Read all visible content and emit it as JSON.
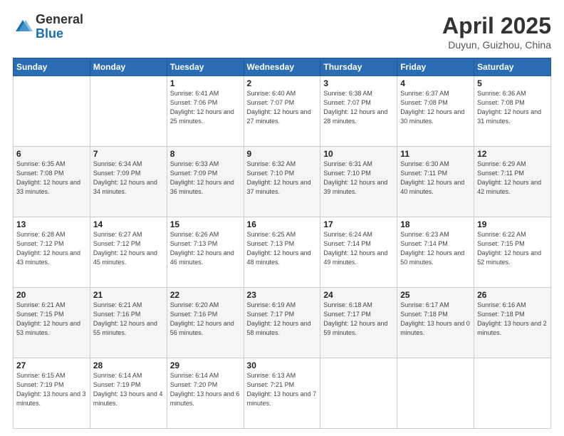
{
  "logo": {
    "general": "General",
    "blue": "Blue"
  },
  "title": "April 2025",
  "location": "Duyun, Guizhou, China",
  "weekdays": [
    "Sunday",
    "Monday",
    "Tuesday",
    "Wednesday",
    "Thursday",
    "Friday",
    "Saturday"
  ],
  "weeks": [
    [
      null,
      null,
      {
        "day": "1",
        "sunrise": "6:41 AM",
        "sunset": "7:06 PM",
        "daylight": "12 hours and 25 minutes."
      },
      {
        "day": "2",
        "sunrise": "6:40 AM",
        "sunset": "7:07 PM",
        "daylight": "12 hours and 27 minutes."
      },
      {
        "day": "3",
        "sunrise": "6:38 AM",
        "sunset": "7:07 PM",
        "daylight": "12 hours and 28 minutes."
      },
      {
        "day": "4",
        "sunrise": "6:37 AM",
        "sunset": "7:08 PM",
        "daylight": "12 hours and 30 minutes."
      },
      {
        "day": "5",
        "sunrise": "6:36 AM",
        "sunset": "7:08 PM",
        "daylight": "12 hours and 31 minutes."
      }
    ],
    [
      {
        "day": "6",
        "sunrise": "6:35 AM",
        "sunset": "7:08 PM",
        "daylight": "12 hours and 33 minutes."
      },
      {
        "day": "7",
        "sunrise": "6:34 AM",
        "sunset": "7:09 PM",
        "daylight": "12 hours and 34 minutes."
      },
      {
        "day": "8",
        "sunrise": "6:33 AM",
        "sunset": "7:09 PM",
        "daylight": "12 hours and 36 minutes."
      },
      {
        "day": "9",
        "sunrise": "6:32 AM",
        "sunset": "7:10 PM",
        "daylight": "12 hours and 37 minutes."
      },
      {
        "day": "10",
        "sunrise": "6:31 AM",
        "sunset": "7:10 PM",
        "daylight": "12 hours and 39 minutes."
      },
      {
        "day": "11",
        "sunrise": "6:30 AM",
        "sunset": "7:11 PM",
        "daylight": "12 hours and 40 minutes."
      },
      {
        "day": "12",
        "sunrise": "6:29 AM",
        "sunset": "7:11 PM",
        "daylight": "12 hours and 42 minutes."
      }
    ],
    [
      {
        "day": "13",
        "sunrise": "6:28 AM",
        "sunset": "7:12 PM",
        "daylight": "12 hours and 43 minutes."
      },
      {
        "day": "14",
        "sunrise": "6:27 AM",
        "sunset": "7:12 PM",
        "daylight": "12 hours and 45 minutes."
      },
      {
        "day": "15",
        "sunrise": "6:26 AM",
        "sunset": "7:13 PM",
        "daylight": "12 hours and 46 minutes."
      },
      {
        "day": "16",
        "sunrise": "6:25 AM",
        "sunset": "7:13 PM",
        "daylight": "12 hours and 48 minutes."
      },
      {
        "day": "17",
        "sunrise": "6:24 AM",
        "sunset": "7:14 PM",
        "daylight": "12 hours and 49 minutes."
      },
      {
        "day": "18",
        "sunrise": "6:23 AM",
        "sunset": "7:14 PM",
        "daylight": "12 hours and 50 minutes."
      },
      {
        "day": "19",
        "sunrise": "6:22 AM",
        "sunset": "7:15 PM",
        "daylight": "12 hours and 52 minutes."
      }
    ],
    [
      {
        "day": "20",
        "sunrise": "6:21 AM",
        "sunset": "7:15 PM",
        "daylight": "12 hours and 53 minutes."
      },
      {
        "day": "21",
        "sunrise": "6:21 AM",
        "sunset": "7:16 PM",
        "daylight": "12 hours and 55 minutes."
      },
      {
        "day": "22",
        "sunrise": "6:20 AM",
        "sunset": "7:16 PM",
        "daylight": "12 hours and 56 minutes."
      },
      {
        "day": "23",
        "sunrise": "6:19 AM",
        "sunset": "7:17 PM",
        "daylight": "12 hours and 58 minutes."
      },
      {
        "day": "24",
        "sunrise": "6:18 AM",
        "sunset": "7:17 PM",
        "daylight": "12 hours and 59 minutes."
      },
      {
        "day": "25",
        "sunrise": "6:17 AM",
        "sunset": "7:18 PM",
        "daylight": "13 hours and 0 minutes."
      },
      {
        "day": "26",
        "sunrise": "6:16 AM",
        "sunset": "7:18 PM",
        "daylight": "13 hours and 2 minutes."
      }
    ],
    [
      {
        "day": "27",
        "sunrise": "6:15 AM",
        "sunset": "7:19 PM",
        "daylight": "13 hours and 3 minutes."
      },
      {
        "day": "28",
        "sunrise": "6:14 AM",
        "sunset": "7:19 PM",
        "daylight": "13 hours and 4 minutes."
      },
      {
        "day": "29",
        "sunrise": "6:14 AM",
        "sunset": "7:20 PM",
        "daylight": "13 hours and 6 minutes."
      },
      {
        "day": "30",
        "sunrise": "6:13 AM",
        "sunset": "7:21 PM",
        "daylight": "13 hours and 7 minutes."
      },
      null,
      null,
      null
    ]
  ]
}
